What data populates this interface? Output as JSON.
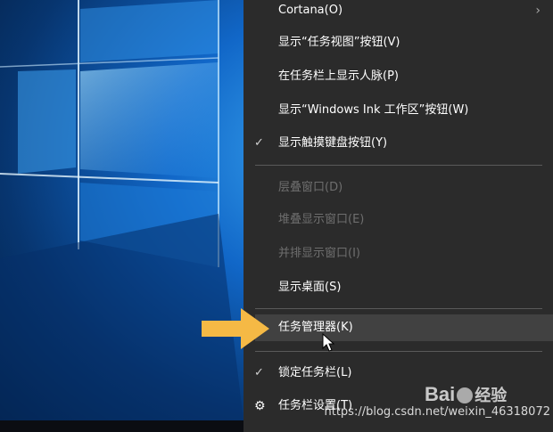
{
  "context_menu": {
    "items": [
      {
        "label": "Cortana(O)",
        "has_submenu": true
      },
      {
        "label": "显示“任务视图”按钮(V)"
      },
      {
        "label": "在任务栏上显示人脉(P)"
      },
      {
        "label": "显示“Windows Ink 工作区”按钮(W)"
      },
      {
        "label": "显示触摸键盘按钮(Y)",
        "checked": true
      },
      {
        "label": "层叠窗口(D)",
        "disabled": true
      },
      {
        "label": "堆叠显示窗口(E)",
        "disabled": true
      },
      {
        "label": "并排显示窗口(I)",
        "disabled": true
      },
      {
        "label": "显示桌面(S)"
      },
      {
        "label": "任务管理器(K)",
        "highlighted": true
      },
      {
        "label": "锁定任务栏(L)",
        "checked": true
      },
      {
        "label": "任务栏设置(T)",
        "icon": "gear-icon"
      }
    ],
    "check_glyph": "✓",
    "gear_glyph": "⚙",
    "chevron_glyph": "›"
  },
  "watermarks": {
    "baidu_prefix": "Bai",
    "baidu_suffix": "经验",
    "csdn": "https://blog.csdn.net/weixin_46318072"
  },
  "colors": {
    "menu_background": "#2b2b2b",
    "menu_highlight": "#414141",
    "disabled_text": "#6e6e6e",
    "arrow": "#f5b945"
  }
}
